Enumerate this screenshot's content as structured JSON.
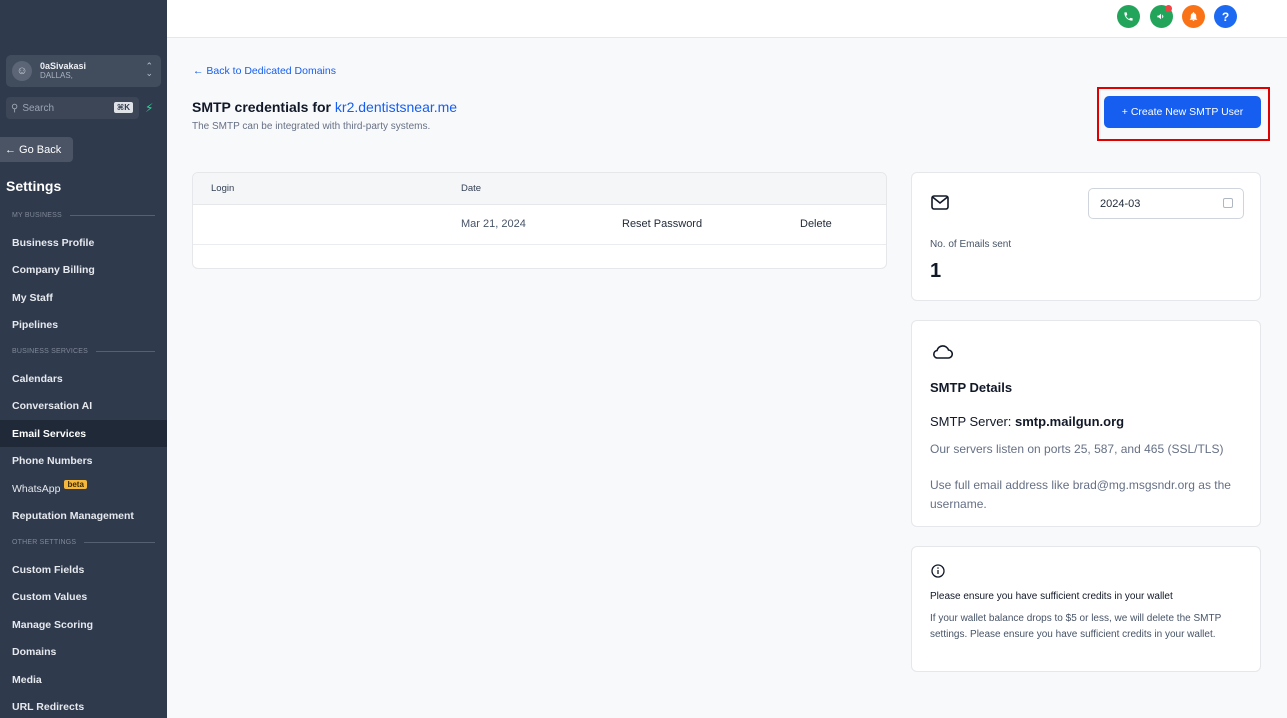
{
  "sidebar": {
    "account": {
      "name": "0aSivakasi",
      "location": "DALLAS,"
    },
    "search": {
      "placeholder": "Search",
      "shortcut": "⌘K"
    },
    "go_back": "← Go Back",
    "title": "Settings",
    "sections": {
      "my_business": "MY BUSINESS",
      "business_services": "BUSINESS SERVICES",
      "other_settings": "OTHER SETTINGS"
    },
    "items": [
      "Business Profile",
      "Company Billing",
      "My Staff",
      "Pipelines",
      "Calendars",
      "Conversation AI",
      "Email Services",
      "Phone Numbers",
      "WhatsApp",
      "Reputation Management",
      "Custom Fields",
      "Custom Values",
      "Manage Scoring",
      "Domains",
      "Media",
      "URL Redirects"
    ],
    "active_item": "Email Services",
    "beta_badge": "beta"
  },
  "header": {
    "icons": [
      "phone-icon",
      "megaphone-icon",
      "bell-icon",
      "help-icon"
    ],
    "colors": {
      "phone": "#22a55b",
      "megaphone": "#22a55b",
      "bell": "#f97316",
      "help": "#1d6af2",
      "dot": "#ef4444"
    }
  },
  "main": {
    "back_link": "←  Back to Dedicated Domains",
    "title_prefix": "SMTP credentials for ",
    "domain": "kr2.dentistsnear.me",
    "subtitle": "The SMTP can be integrated with third-party systems.",
    "create_button": "+  Create New SMTP User",
    "table": {
      "columns": [
        "Login",
        "Date"
      ],
      "rows": [
        {
          "login": "",
          "date": "Mar 21, 2024",
          "reset": "Reset Password",
          "delete": "Delete"
        }
      ]
    }
  },
  "stats": {
    "month_value": "2024-03",
    "label": "No. of Emails sent",
    "count": "1"
  },
  "smtp": {
    "heading": "SMTP Details",
    "server_label": "SMTP Server: ",
    "server_value": "smtp.mailgun.org",
    "ports_text": "Our servers listen on ports 25, 587, and 465 (SSL/TLS)",
    "username_text": "Use full email address like brad@mg.msgsndr.org as the username."
  },
  "wallet": {
    "heading": "Please ensure you have sufficient credits in your wallet",
    "body": "If your wallet balance drops to $5 or less, we will delete the SMTP settings. Please ensure you have sufficient credits in your wallet."
  },
  "colors": {
    "accent": "#155eef",
    "sidebar_bg": "#2f3a4c",
    "highlight_frame": "#e00000"
  }
}
